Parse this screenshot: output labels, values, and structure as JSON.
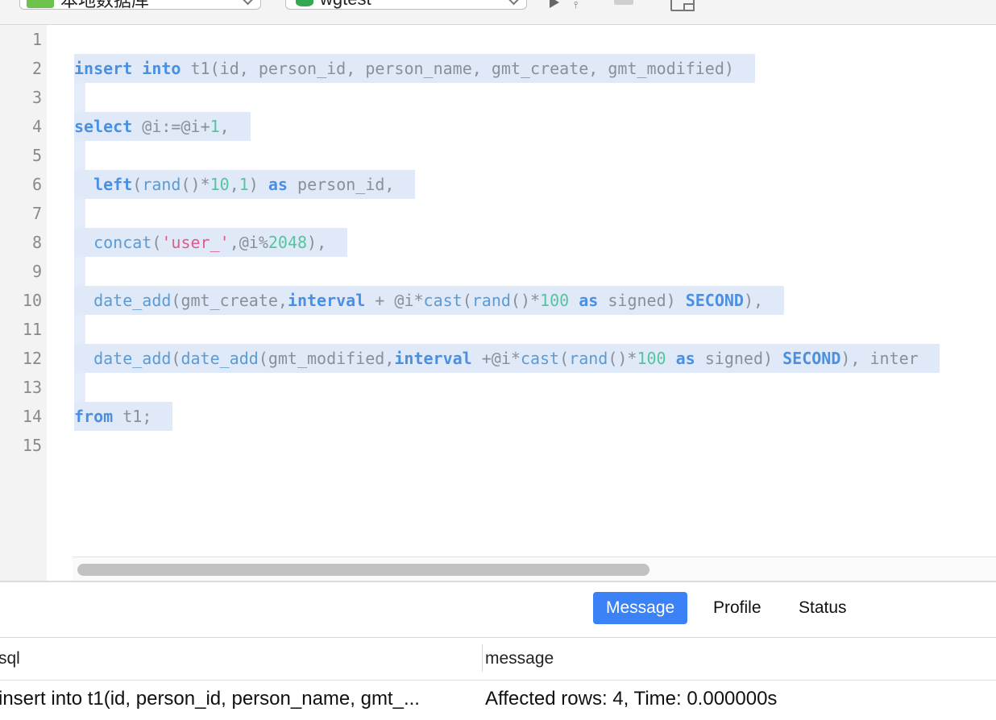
{
  "toolbar": {
    "connection_label": "本地数据库",
    "database_label": "wgtest"
  },
  "editor": {
    "line_numbers": [
      "1",
      "2",
      "3",
      "4",
      "5",
      "6",
      "7",
      "8",
      "9",
      "10",
      "11",
      "12",
      "13",
      "14",
      "15"
    ],
    "lines": [
      {
        "n": 1,
        "text": ""
      },
      {
        "n": 2,
        "text": "insert into t1(id, person_id, person_name, gmt_create, gmt_modified)"
      },
      {
        "n": 3,
        "text": ""
      },
      {
        "n": 4,
        "text": "select @i:=@i+1,"
      },
      {
        "n": 5,
        "text": ""
      },
      {
        "n": 6,
        "text": "  left(rand()*10,1) as person_id,"
      },
      {
        "n": 7,
        "text": ""
      },
      {
        "n": 8,
        "text": "  concat('user_',@i%2048),"
      },
      {
        "n": 9,
        "text": ""
      },
      {
        "n": 10,
        "text": "  date_add(gmt_create,interval + @i*cast(rand()*100 as signed) SECOND),"
      },
      {
        "n": 11,
        "text": ""
      },
      {
        "n": 12,
        "text": "  date_add(date_add(gmt_modified,interval +@i*cast(rand()*100 as signed) SECOND), inter"
      },
      {
        "n": 13,
        "text": ""
      },
      {
        "n": 14,
        "text": "from t1;"
      },
      {
        "n": 15,
        "text": ""
      }
    ]
  },
  "results": {
    "tabs": [
      {
        "label": "Message",
        "active": true
      },
      {
        "label": "Profile",
        "active": false
      },
      {
        "label": "Status",
        "active": false
      }
    ],
    "columns": [
      "sql",
      "message"
    ],
    "rows": [
      {
        "sql": "insert into t1(id, person_id, person_name, gmt_...",
        "message": "Affected rows: 4, Time: 0.000000s"
      }
    ]
  },
  "colors": {
    "keyword": "#4a90e2",
    "function": "#5b9bd5",
    "number": "#54c59f",
    "string": "#e05a8a",
    "selection": "#dfe9f8",
    "active_tab": "#3b82f6"
  }
}
